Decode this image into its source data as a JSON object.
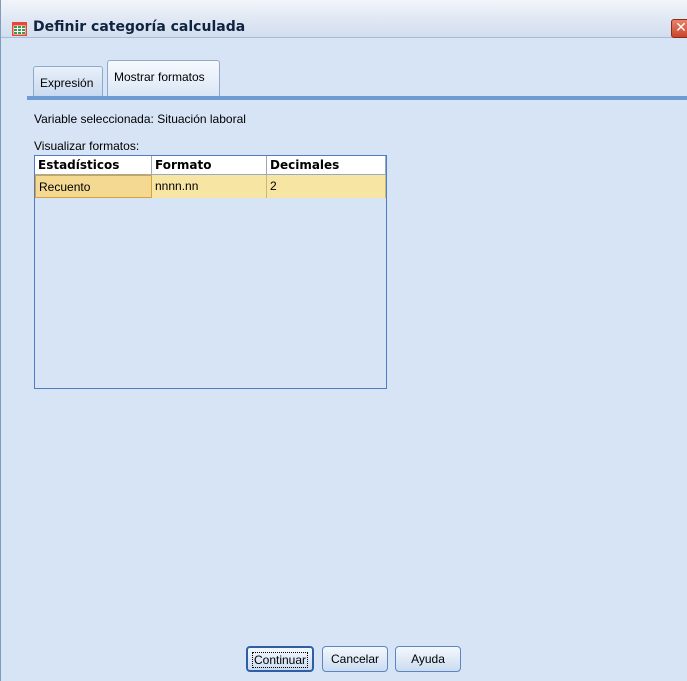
{
  "window": {
    "title": "Definir categoría calculada",
    "close_glyph": "✕"
  },
  "tabs": [
    {
      "label": "Expresión",
      "active": false
    },
    {
      "label": "Mostrar formatos",
      "active": true
    }
  ],
  "selected_variable_text": "Variable seleccionada: Situación laboral",
  "formats_label": "Visualizar formatos:",
  "grid": {
    "columns": [
      "Estadísticos",
      "Formato",
      "Decimales"
    ],
    "rows": [
      [
        "Recuento",
        "nnnn.nn",
        "2"
      ]
    ]
  },
  "buttons": {
    "continue": "Continuar",
    "cancel": "Cancelar",
    "help": "Ayuda"
  },
  "icons": {
    "title_icon": "table-grid-icon",
    "close_icon": "close-icon"
  },
  "colors": {
    "accent": "#6e9bd1",
    "selected_row": "#f7e6a3",
    "dialog_bg": "#d6e4f5"
  }
}
